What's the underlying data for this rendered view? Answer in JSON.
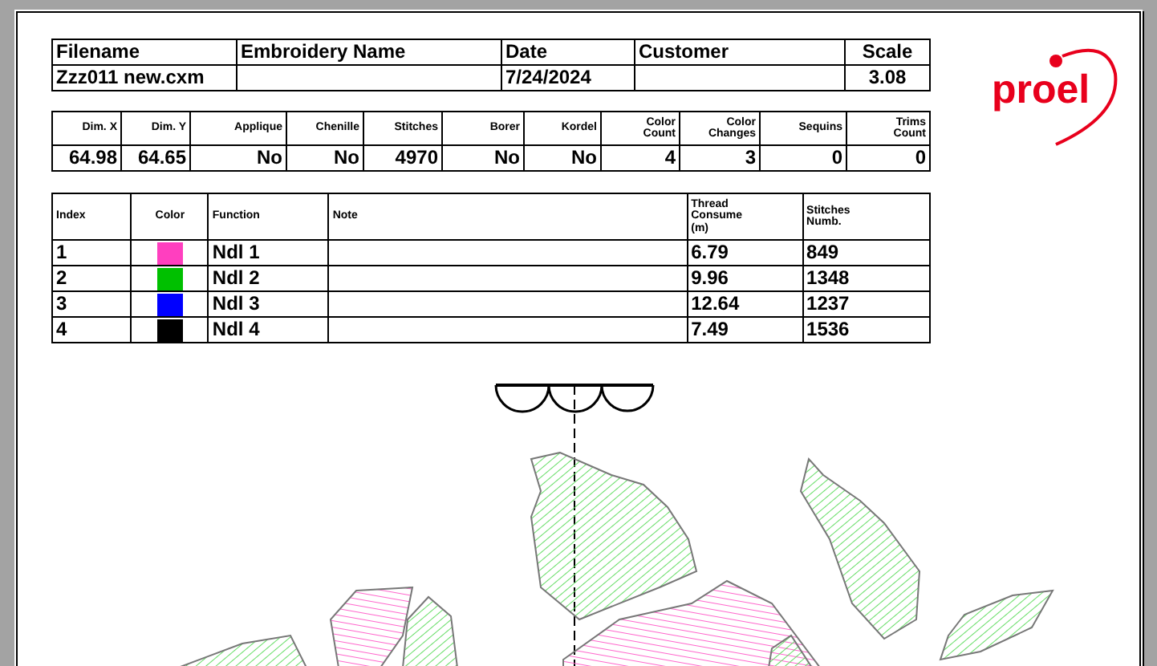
{
  "file_info": {
    "columns": [
      {
        "label": "Filename",
        "value": "Zzz011 new.cxm"
      },
      {
        "label": "Embroidery Name"
      },
      {
        "label": "Date",
        "value": "7/24/2024"
      },
      {
        "label": "Customer"
      },
      {
        "label": "Scale",
        "value": "3.08"
      }
    ]
  },
  "logo": {
    "text": "proel"
  },
  "stats": {
    "columns": [
      [
        "Dim. X"
      ],
      [
        "Dim. Y"
      ],
      [
        "Applique"
      ],
      [
        "Chenille"
      ],
      [
        "Stitches"
      ],
      [
        "Borer"
      ],
      [
        "Kordel"
      ],
      [
        "Color",
        "Count"
      ],
      [
        "Color",
        "Changes"
      ],
      [
        "Sequins"
      ],
      [
        "Trims",
        "Count"
      ]
    ],
    "values": [
      "64.98",
      "64.65",
      "No",
      "No",
      "4970",
      "No",
      "No",
      "4",
      "3",
      "0",
      "0"
    ]
  },
  "needles": {
    "columns": [
      [
        "Index"
      ],
      [
        "Color"
      ],
      [
        "Function"
      ],
      [
        "Note"
      ],
      [
        "Thread",
        "Consume",
        "(m)"
      ],
      [
        "Stitches",
        "Numb."
      ]
    ],
    "rows": [
      {
        "index": "1",
        "color": "#ff3fbf",
        "function": "Ndl 1",
        "thread": "6.79",
        "stitches": "849"
      },
      {
        "index": "2",
        "color": "#00c000",
        "function": "Ndl 2",
        "thread": "9.96",
        "stitches": "1348"
      },
      {
        "index": "3",
        "color": "#0000ff",
        "function": "Ndl 3",
        "thread": "12.64",
        "stitches": "1237"
      },
      {
        "index": "4",
        "color": "#000000",
        "function": "Ndl 4",
        "thread": "7.49",
        "stitches": "1536"
      }
    ]
  }
}
